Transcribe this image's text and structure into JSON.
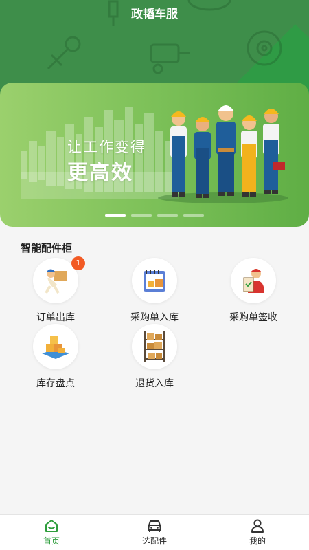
{
  "header": {
    "title": "政韬车服"
  },
  "banner": {
    "slogan_line1": "让工作变得",
    "slogan_line2": "更高效",
    "slides": 4,
    "active_slide": 1
  },
  "section": {
    "title": "智能配件柜"
  },
  "features": [
    {
      "label": "订单出库",
      "badge": "1",
      "icon": "delivery-courier-icon"
    },
    {
      "label": "采购单入库",
      "icon": "purchase-boxes-icon"
    },
    {
      "label": "采购单签收",
      "icon": "signing-clipboard-icon"
    },
    {
      "label": "库存盘点",
      "icon": "inventory-boxes-icon"
    },
    {
      "label": "退货入库",
      "icon": "warehouse-shelf-icon"
    }
  ],
  "tabbar": {
    "items": [
      {
        "label": "首页",
        "icon": "home-icon",
        "active": true
      },
      {
        "label": "选配件",
        "icon": "car-icon",
        "active": false
      },
      {
        "label": "我的",
        "icon": "user-icon",
        "active": false
      }
    ]
  },
  "colors": {
    "header_green": "#3e8e4a",
    "accent_green": "#2e9e3c",
    "badge_orange": "#f25a24"
  }
}
